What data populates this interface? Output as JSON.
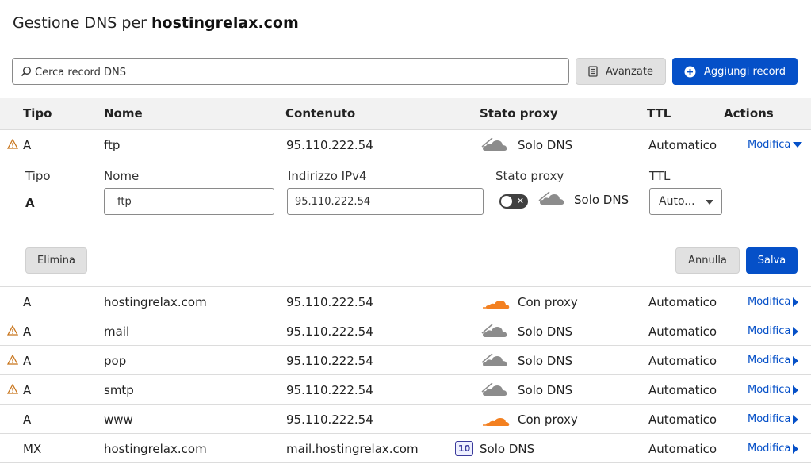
{
  "header": {
    "title_prefix": "Gestione DNS per",
    "domain": "hostingrelax.com"
  },
  "toolbar": {
    "search_placeholder": "Cerca record DNS",
    "advanced_label": "Avanzate",
    "add_label": "Aggiungi record"
  },
  "table": {
    "headers": {
      "type": "Tipo",
      "name": "Nome",
      "content": "Contenuto",
      "proxy": "Stato proxy",
      "ttl": "TTL",
      "actions": "Actions"
    },
    "rows": [
      {
        "warning": true,
        "type": "A",
        "name": "ftp",
        "content": "95.110.222.54",
        "proxy_status": "Solo DNS",
        "proxied": false,
        "ttl": "Automatico",
        "action": "Modifica",
        "expanded": true
      },
      {
        "warning": false,
        "type": "A",
        "name": "hostingrelax.com",
        "content": "95.110.222.54",
        "proxy_status": "Con proxy",
        "proxied": true,
        "ttl": "Automatico",
        "action": "Modifica"
      },
      {
        "warning": true,
        "type": "A",
        "name": "mail",
        "content": "95.110.222.54",
        "proxy_status": "Solo DNS",
        "proxied": false,
        "ttl": "Automatico",
        "action": "Modifica"
      },
      {
        "warning": true,
        "type": "A",
        "name": "pop",
        "content": "95.110.222.54",
        "proxy_status": "Solo DNS",
        "proxied": false,
        "ttl": "Automatico",
        "action": "Modifica"
      },
      {
        "warning": true,
        "type": "A",
        "name": "smtp",
        "content": "95.110.222.54",
        "proxy_status": "Solo DNS",
        "proxied": false,
        "ttl": "Automatico",
        "action": "Modifica"
      },
      {
        "warning": false,
        "type": "A",
        "name": "www",
        "content": "95.110.222.54",
        "proxy_status": "Con proxy",
        "proxied": true,
        "ttl": "Automatico",
        "action": "Modifica"
      },
      {
        "warning": false,
        "type": "MX",
        "name": "hostingrelax.com",
        "content": "mail.hostingrelax.com",
        "priority": "10",
        "proxy_status": "Solo DNS",
        "proxied": false,
        "ttl": "Automatico",
        "action": "Modifica"
      }
    ]
  },
  "editor": {
    "type_label": "Tipo",
    "type_value": "A",
    "name_label": "Nome",
    "name_value": "ftp",
    "ipv4_label": "Indirizzo IPv4",
    "ipv4_value": "95.110.222.54",
    "proxy_label": "Stato proxy",
    "proxy_value": "Solo DNS",
    "proxy_toggle_symbol": "✕",
    "ttl_label": "TTL",
    "ttl_value": "Auto...",
    "delete_label": "Elimina",
    "cancel_label": "Annulla",
    "save_label": "Salva"
  },
  "colors": {
    "accent": "#0550c8",
    "proxy_orange": "#f38020",
    "dns_grey": "#8c8c8c",
    "warning": "#c8741a"
  },
  "icons": {
    "search": "search-icon",
    "advanced": "document-icon",
    "add": "plus-circle-icon",
    "warning": "warning-icon",
    "cloud_proxied": "cloud-orange-icon",
    "cloud_dns": "cloud-grey-icon"
  }
}
